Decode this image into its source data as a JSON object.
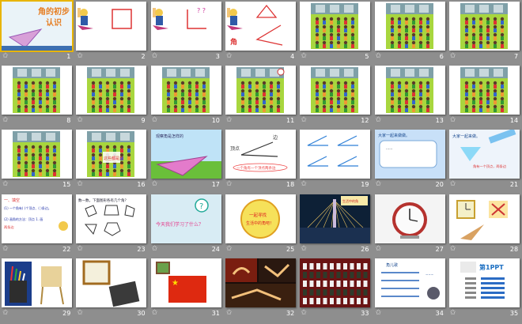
{
  "window": {
    "title": "PowerPoint slide sorter",
    "selected_slide": "1"
  },
  "slides": [
    {
      "number": "1",
      "title_line1": "角的初步",
      "title_line2": "认识"
    },
    {
      "number": "2"
    },
    {
      "number": "3"
    },
    {
      "number": "4",
      "label": "角"
    },
    {
      "number": "5"
    },
    {
      "number": "6"
    },
    {
      "number": "7"
    },
    {
      "number": "8"
    },
    {
      "number": "9"
    },
    {
      "number": "10"
    },
    {
      "number": "11"
    },
    {
      "number": "12"
    },
    {
      "number": "13"
    },
    {
      "number": "14"
    },
    {
      "number": "15"
    },
    {
      "number": "16",
      "text": "这些都是角"
    },
    {
      "number": "17",
      "text": "观察角是怎样的"
    },
    {
      "number": "18",
      "label_top": "顶点",
      "label_edge": "边",
      "caption": "一个角有一个顶点两条边"
    },
    {
      "number": "19"
    },
    {
      "number": "20",
      "text": "大家一起来做做。"
    },
    {
      "number": "21",
      "text": "大家一起来做。",
      "caption": "角有一个顶点，两条边"
    },
    {
      "number": "22",
      "line1": "一、填空",
      "line2": "(1) 一个角有( )个顶点、( )条边。",
      "line3": "(2) 画角的方法：顶点 1. 画",
      "line4": "两条边"
    },
    {
      "number": "23",
      "text": "数一数，下面图形各有几个角？"
    },
    {
      "number": "24",
      "text": "今天我们学习了什么？"
    },
    {
      "number": "25",
      "text1": "一起寻找",
      "text2": "生活中的角吧！"
    },
    {
      "number": "26",
      "caption": "生活中的角"
    },
    {
      "number": "27"
    },
    {
      "number": "28"
    },
    {
      "number": "29"
    },
    {
      "number": "30"
    },
    {
      "number": "31"
    },
    {
      "number": "32"
    },
    {
      "number": "33"
    },
    {
      "number": "34",
      "text": "角儿歌"
    },
    {
      "number": "35",
      "brand": "第1PPT"
    }
  ],
  "icons": {
    "slide_transition": "star-icon"
  }
}
